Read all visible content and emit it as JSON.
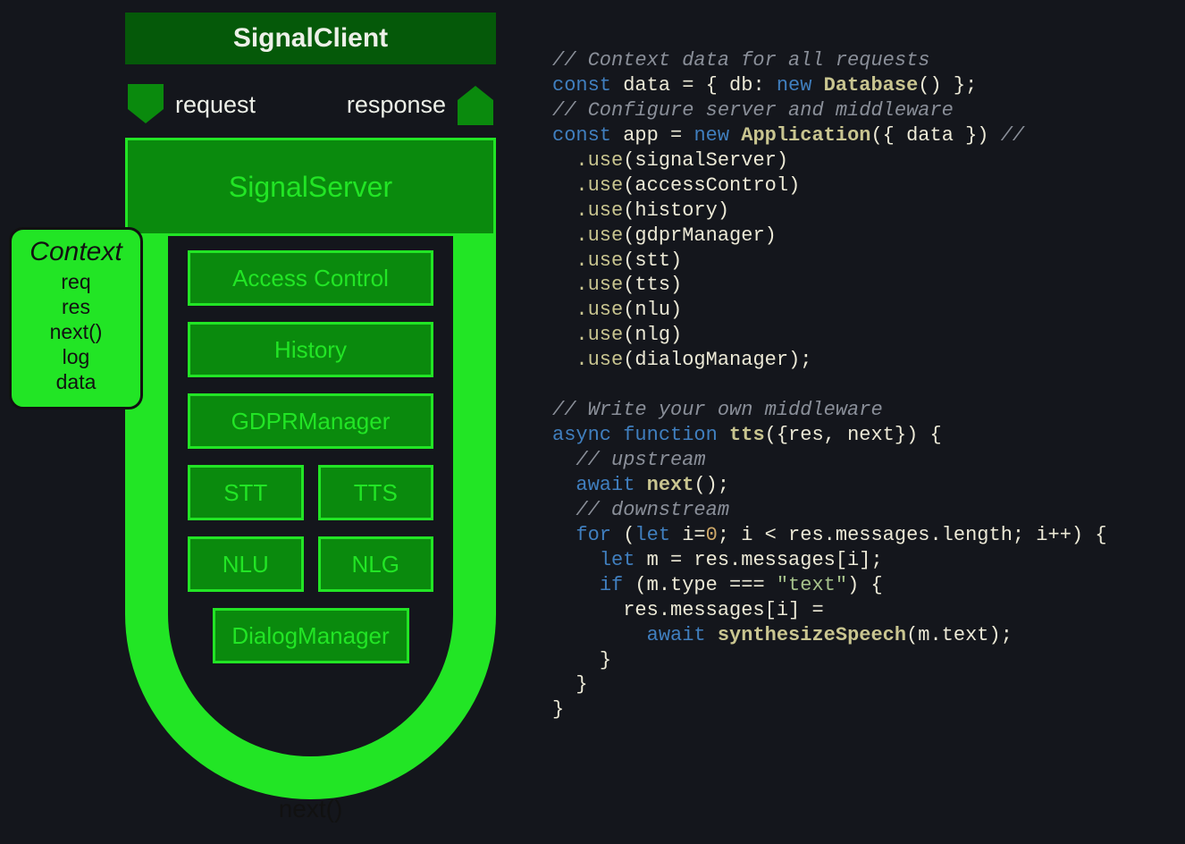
{
  "diagram": {
    "client_label": "SignalClient",
    "request_label": "request",
    "response_label": "response",
    "server_label": "SignalServer",
    "context": {
      "title": "Context",
      "items": [
        "req",
        "res",
        "next()",
        "log",
        "data"
      ]
    },
    "middleware": {
      "row1": "Access Control",
      "row2": "History",
      "row3": "GDPRManager",
      "row4a": "STT",
      "row4b": "TTS",
      "row5a": "NLU",
      "row5b": "NLG",
      "row6": "DialogManager"
    },
    "next_label": "next()"
  },
  "code": {
    "c1": "// Context data for all requests",
    "l2_kw": "const",
    "l2_id": "data",
    "l2_eq": " = { ",
    "l2_db": "db",
    "l2_colon": ": ",
    "l2_new": "new",
    "l2_ctor": "Database",
    "l2_end": "() };",
    "c3": "// Configure server and middleware",
    "l4_kw": "const",
    "l4_id": "app",
    "l4_eq": " = ",
    "l4_new": "new",
    "l4_ctor": "Application",
    "l4_args": "({ data }) ",
    "l4_tail": "//",
    "use": ".use",
    "u1": "signalServer",
    "u2": "accessControl",
    "u3": "history",
    "u4": "gdprManager",
    "u5": "stt",
    "u6": "tts",
    "u7": "nlu",
    "u8": "nlg",
    "u9": "dialogManager",
    "c_mw": "// Write your own middleware",
    "fn_async": "async",
    "fn_function": "function",
    "fn_name": "tts",
    "fn_args": "({res, next}) {",
    "c_up": "// upstream",
    "await": "await",
    "next_call": "next",
    "next_tail": "();",
    "c_down": "// downstream",
    "for_kw": "for",
    "for_open": " (",
    "let_kw": "let",
    "for_init": " i=",
    "zero": "0",
    "for_cond": "; i < res.messages.length; i++) {",
    "let_m": "let",
    "m_assign": " m = res.messages[i];",
    "if_kw": "if",
    "if_cond_a": " (m.type === ",
    "if_str": "\"text\"",
    "if_cond_b": ") {",
    "assign_line": "      res.messages[i] =",
    "await2": "await",
    "synth": "synthesizeSpeech",
    "synth_args": "(m.text);",
    "brace": "}",
    "brace2": "}",
    "brace3": "}",
    "brace4": "}"
  }
}
